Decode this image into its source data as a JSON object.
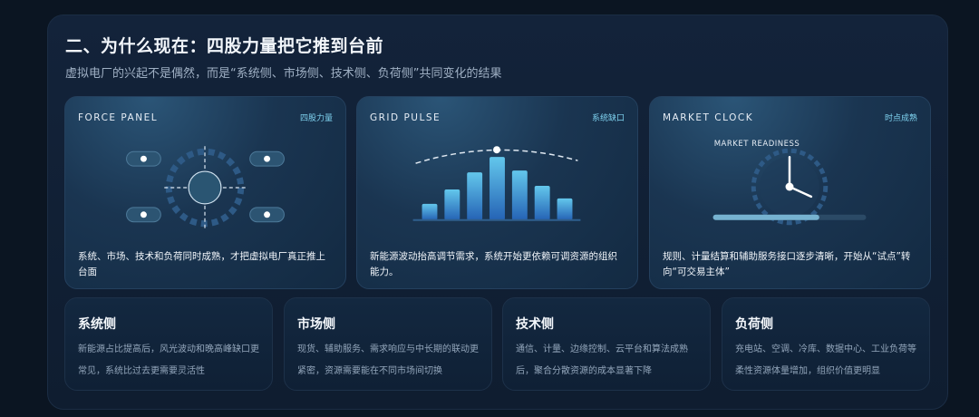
{
  "header": {
    "title": "二、为什么现在：四股力量把它推到台前",
    "subtitle": "虚拟电厂的兴起不是偶然，而是“系统侧、市场侧、技术侧、负荷侧”共同变化的结果"
  },
  "cards": [
    {
      "label": "FORCE PANEL",
      "tag": "四股力量",
      "description": "系统、市场、技术和负荷同时成熟，才把虚拟电厂真正推上台面"
    },
    {
      "label": "GRID PULSE",
      "tag": "系统缺口",
      "description": "新能源波动抬高调节需求，系统开始更依赖可调资源的组织能力。"
    },
    {
      "label": "MARKET CLOCK",
      "tag": "时点成熟",
      "visual_label": "MARKET READINESS",
      "description": "规则、计量结算和辅助服务接口逐步清晰，开始从“试点”转向“可交易主体”"
    }
  ],
  "forces": [
    {
      "title": "系统侧",
      "description": "新能源占比提高后，风光波动和晚高峰缺口更常见，系统比过去更需要灵活性"
    },
    {
      "title": "市场侧",
      "description": "现货、辅助服务、需求响应与中长期的联动更紧密，资源需要能在不同市场间切换"
    },
    {
      "title": "技术侧",
      "description": "通信、计量、边缘控制、云平台和算法成熟后，聚合分散资源的成本显著下降"
    },
    {
      "title": "负荷侧",
      "description": "充电站、空调、冷库、数据中心、工业负荷等柔性资源体量增加，组织价值更明显"
    }
  ],
  "colors": {
    "accent_blue": "#3f8fe0",
    "accent_cyan": "#7fd3f0"
  }
}
